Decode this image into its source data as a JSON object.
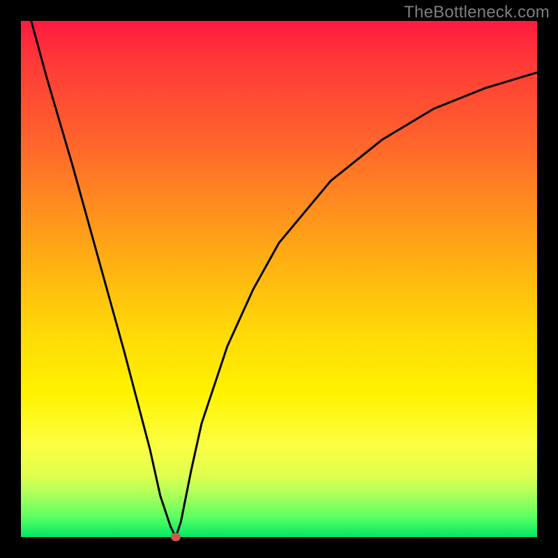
{
  "watermark": "TheBottleneck.com",
  "chart_data": {
    "type": "line",
    "title": "",
    "xlabel": "",
    "ylabel": "",
    "xlim": [
      0,
      100
    ],
    "ylim": [
      0,
      100
    ],
    "x": [
      2,
      5,
      10,
      15,
      20,
      25,
      27,
      29,
      30,
      31,
      33,
      35,
      40,
      45,
      50,
      55,
      60,
      65,
      70,
      75,
      80,
      85,
      90,
      95,
      100
    ],
    "values": [
      100,
      89,
      72,
      54,
      36,
      17,
      8,
      2,
      0,
      3,
      13,
      22,
      37,
      48,
      57,
      63,
      69,
      73,
      77,
      80,
      83,
      85,
      87,
      88.5,
      90
    ],
    "minimum_point": {
      "x": 30,
      "y": 0
    },
    "gradient_meaning": "green (bottom) = good, red (top) = bad",
    "grid": false
  },
  "colors": {
    "background": "#000000",
    "curve": "#000000",
    "dot": "#cc5a4a"
  }
}
